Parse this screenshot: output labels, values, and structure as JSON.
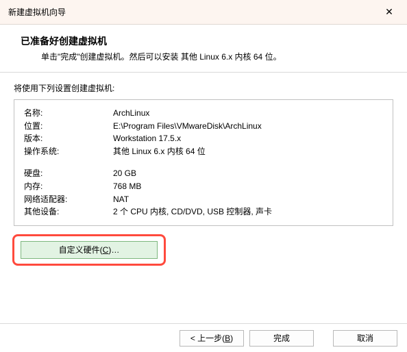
{
  "titlebar": {
    "title": "新建虚拟机向导",
    "close_glyph": "✕"
  },
  "header": {
    "heading": "已准备好创建虚拟机",
    "subheading": "单击\"完成\"创建虚拟机。然后可以安装 其他 Linux 6.x 内核 64 位。"
  },
  "intro": "将使用下列设置创建虚拟机:",
  "settings": {
    "name_label": "名称:",
    "name_value": "ArchLinux",
    "location_label": "位置:",
    "location_value": "E:\\Program Files\\VMwareDisk\\ArchLinux",
    "version_label": "版本:",
    "version_value": "Workstation 17.5.x",
    "os_label": "操作系统:",
    "os_value": "其他 Linux 6.x 内核 64 位",
    "disk_label": "硬盘:",
    "disk_value": "20 GB",
    "memory_label": "内存:",
    "memory_value": "768 MB",
    "net_label": "网络适配器:",
    "net_value": "NAT",
    "other_label": "其他设备:",
    "other_value": "2 个 CPU 内核, CD/DVD, USB 控制器, 声卡"
  },
  "buttons": {
    "customize_pre": "自定义硬件(",
    "customize_hot": "C",
    "customize_post": ")…",
    "back_pre": "< 上一步(",
    "back_hot": "B",
    "back_post": ")",
    "finish": "完成",
    "cancel": "取消"
  }
}
